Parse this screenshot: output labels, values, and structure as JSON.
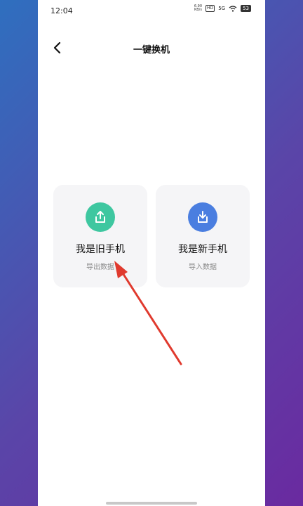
{
  "status_bar": {
    "time": "12:04",
    "net_speed_value": "6.90",
    "net_speed_unit": "KB/s",
    "hd_label": "HD",
    "signal_label": "5G",
    "battery_level": "53"
  },
  "header": {
    "title": "一键换机"
  },
  "cards": [
    {
      "title": "我是旧手机",
      "subtitle": "导出数据",
      "icon": "upload-icon",
      "color": "#3ec7a0"
    },
    {
      "title": "我是新手机",
      "subtitle": "导入数据",
      "icon": "download-icon",
      "color": "#4a7ee0"
    }
  ],
  "annotation": {
    "arrow_color": "#e03a2e"
  }
}
